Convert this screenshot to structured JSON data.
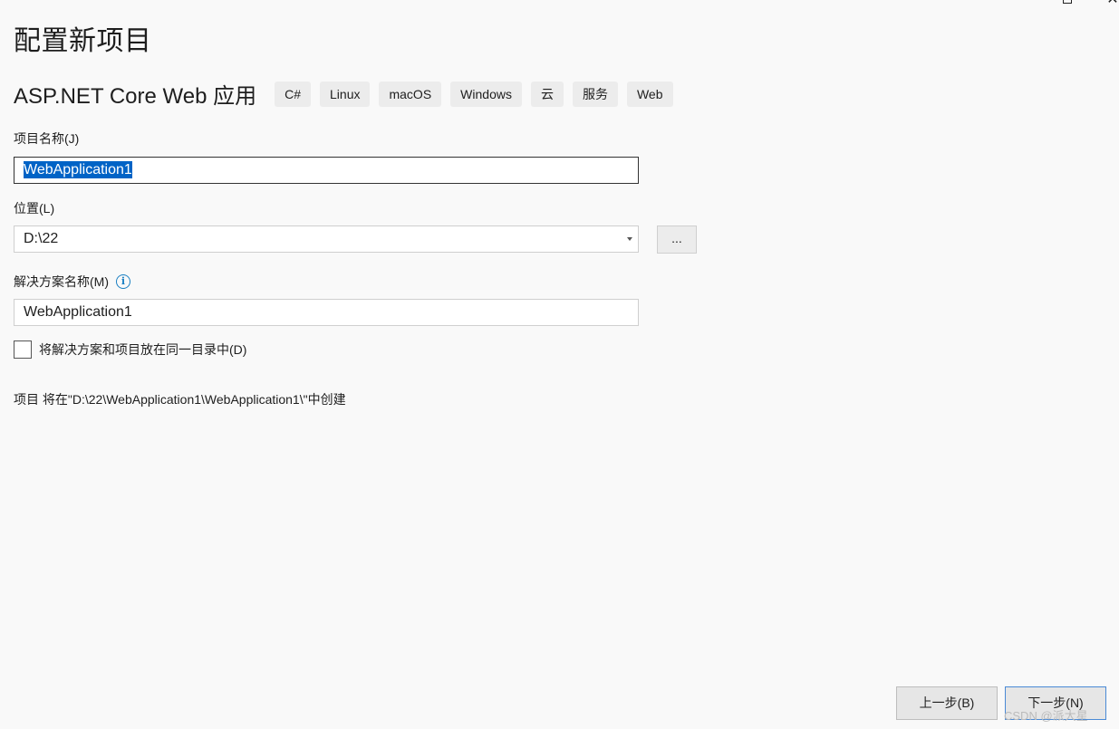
{
  "window": {
    "maximize_icon": "maximize-icon",
    "close_icon": "close-icon",
    "close_glyph": "✕"
  },
  "page": {
    "title": "配置新项目"
  },
  "template": {
    "name": "ASP.NET Core Web 应用",
    "tags": [
      "C#",
      "Linux",
      "macOS",
      "Windows",
      "云",
      "服务",
      "Web"
    ]
  },
  "form": {
    "project_name": {
      "label": "项目名称(J)",
      "value": "WebApplication1"
    },
    "location": {
      "label": "位置(L)",
      "value": "D:\\22",
      "browse_label": "..."
    },
    "solution_name": {
      "label": "解决方案名称(M)",
      "info_glyph": "i",
      "value": "WebApplication1"
    },
    "same_directory": {
      "label": "将解决方案和项目放在同一目录中(D)",
      "checked": false
    },
    "path_note": "项目 将在\"D:\\22\\WebApplication1\\WebApplication1\\\"中创建"
  },
  "footer": {
    "back_label": "上一步(B)",
    "next_label": "下一步(N)"
  },
  "watermark": "CSDN @派大星",
  "colors": {
    "selection": "#0063c6",
    "info_icon": "#1a7fc2",
    "next_border": "#4a8ad6",
    "background": "#f9f9f9"
  }
}
